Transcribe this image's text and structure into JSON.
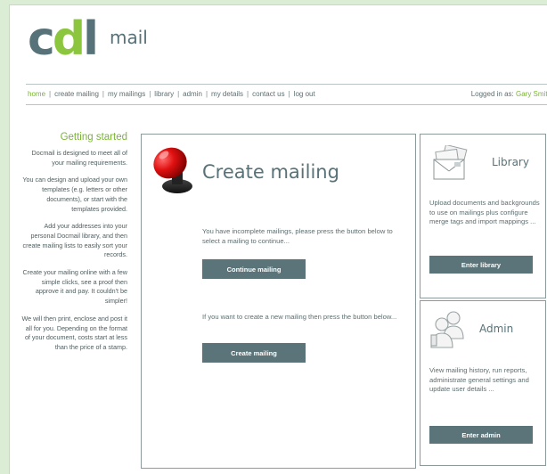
{
  "logo": {
    "c": "c",
    "d": "d",
    "l": "l",
    "mail": "mail"
  },
  "nav": {
    "items": [
      "home",
      "create mailing",
      "my mailings",
      "library",
      "admin",
      "my details",
      "contact us",
      "log out"
    ],
    "separator": "|",
    "logged_in_label": "Logged in as:",
    "user_name": "Gary Smith"
  },
  "sidebar": {
    "title": "Getting started",
    "paragraphs": [
      "Docmail is designed to meet all of your mailing requirements.",
      "You can design and upload your own templates (e.g. letters or other documents), or start with the templates provided.",
      "Add your addresses into your personal Docmail library, and then create mailing lists to easily sort your records.",
      "Create your mailing online with a few simple clicks, see a proof then approve it and pay.  It couldn't be simpler!",
      "We will then print, enclose and post it all for you. Depending on the format of your document, costs start at less than the price of a stamp."
    ]
  },
  "create": {
    "title": "Create mailing",
    "text1": "You have incomplete mailings, please press the button below to select a mailing to continue...",
    "button1": "Continue mailing",
    "text2": "If you want to create a new mailing then press the button below...",
    "button2": "Create mailing"
  },
  "library": {
    "title": "Library",
    "text": "Upload documents and backgrounds to use on mailings plus configure merge tags and import mappings ...",
    "button": "Enter library"
  },
  "admin": {
    "title": "Admin",
    "text": "View mailing history, run reports, administrate general settings and update user details ...",
    "button": "Enter admin"
  },
  "colors": {
    "accent": "#7ab532",
    "slate": "#577278",
    "button": "#5a7479",
    "background": "#dcedd6"
  }
}
